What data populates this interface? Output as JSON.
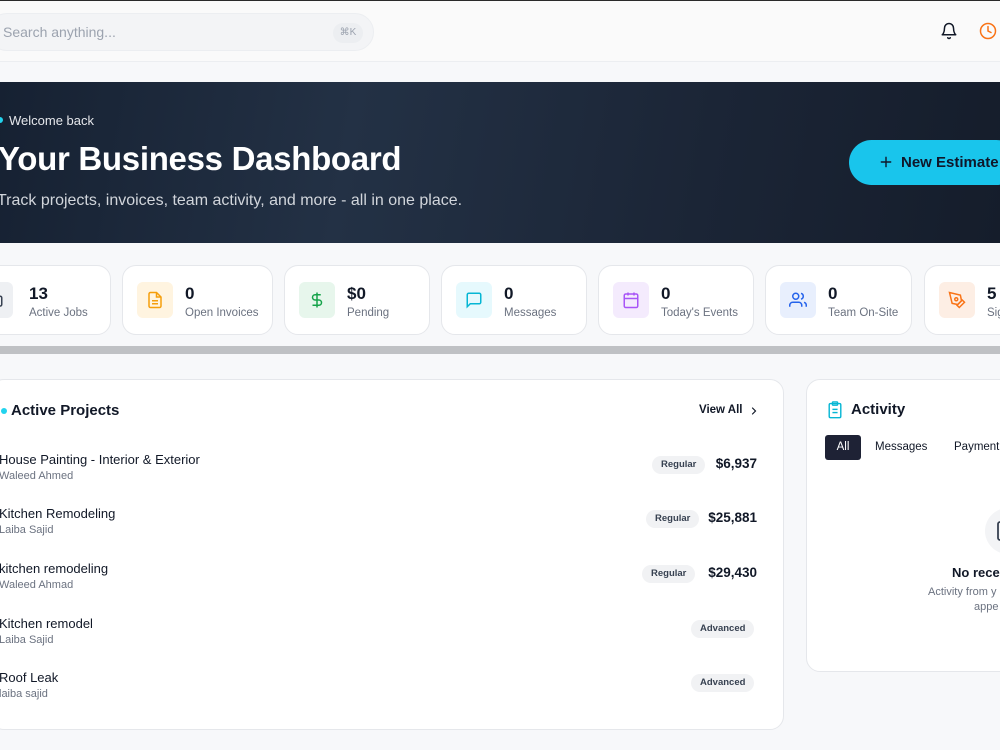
{
  "topbar": {
    "search_placeholder": "Search anything...",
    "shortcut": "⌘K",
    "icons": [
      "bell-icon",
      "clock-icon"
    ]
  },
  "hero": {
    "welcome": "Welcome back",
    "title": "Your Business Dashboard",
    "subtitle": "Track projects, invoices, team activity, and more - all in one place.",
    "button_label": "New Estimate"
  },
  "stats": [
    {
      "value": "13",
      "label": "Active Jobs",
      "icon": "briefcase-icon",
      "color": "#4b5563"
    },
    {
      "value": "0",
      "label": "Open Invoices",
      "icon": "file-text-icon",
      "color": "#f59e0b"
    },
    {
      "value": "$0",
      "label": "Pending",
      "icon": "dollar-icon",
      "color": "#16a34a"
    },
    {
      "value": "0",
      "label": "Messages",
      "icon": "message-icon",
      "color": "#06b6d4"
    },
    {
      "value": "0",
      "label": "Today's Events",
      "icon": "calendar-icon",
      "color": "#a855f7"
    },
    {
      "value": "0",
      "label": "Team On-Site",
      "icon": "users-icon",
      "color": "#2563eb"
    },
    {
      "value": "5",
      "label": "Sig",
      "icon": "pen-tool-icon",
      "color": "#f97316"
    }
  ],
  "projects": {
    "title": "Active Projects",
    "view_all": "View All",
    "rows": [
      {
        "name": "House Painting - Interior & Exterior",
        "client": "Waleed Ahmed",
        "badge": "Regular",
        "amount": "$6,937"
      },
      {
        "name": "Kitchen Remodeling",
        "client": "Laiba Sajid",
        "badge": "Regular",
        "amount": "$25,881"
      },
      {
        "name": "kitchen remodeling",
        "client": "Waleed Ahmad",
        "badge": "Regular",
        "amount": "$29,430"
      },
      {
        "name": "Kitchen remodel",
        "client": "Laiba Sajid",
        "badge": "Advanced",
        "amount": ""
      },
      {
        "name": "Roof Leak",
        "client": "laiba sajid",
        "badge": "Advanced",
        "amount": ""
      }
    ]
  },
  "activity": {
    "title": "Activity",
    "tabs": [
      "All",
      "Messages",
      "Payment"
    ],
    "empty_title": "No rece",
    "empty_line1": "Activity from y",
    "empty_line2": "appe"
  },
  "colors": {
    "accent": "#19c5ec",
    "hero_bg": "#1b2536"
  }
}
